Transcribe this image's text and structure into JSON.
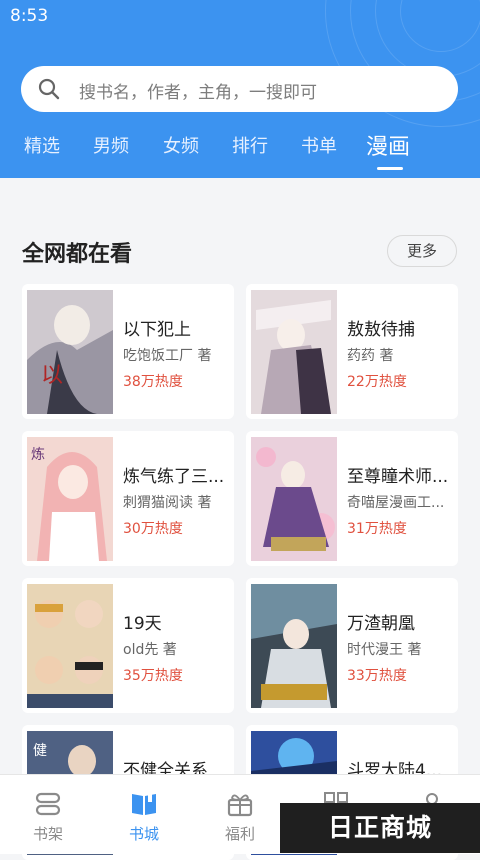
{
  "status_bar": {
    "time": "8:53"
  },
  "search": {
    "placeholder": "搜书名，作者，主角，一搜即可"
  },
  "tabs": [
    "精选",
    "男频",
    "女频",
    "排行",
    "书单",
    "漫画"
  ],
  "active_tab": "漫画",
  "section": {
    "title": "全网都在看",
    "more_label": "更多"
  },
  "books": [
    {
      "title": "以下犯上",
      "author": "吃饱饭工厂 著",
      "heat": "38万热度",
      "cover_color": "#c9c5cb"
    },
    {
      "title": "敖敖待捕",
      "author": "药药 著",
      "heat": "22万热度",
      "cover_color": "#d9cfd3"
    },
    {
      "title": "炼气练了三...",
      "author": "刺猬猫阅读 著",
      "heat": "30万热度",
      "cover_color": "#f1d2cf"
    },
    {
      "title": "至尊瞳术师...",
      "author": "奇喵屋漫画工...",
      "heat": "31万热度",
      "cover_color": "#e6c1d0"
    },
    {
      "title": "19天",
      "author": "old先 著",
      "heat": "35万热度",
      "cover_color": "#d6c09d"
    },
    {
      "title": "万渣朝凰",
      "author": "时代漫王 著",
      "heat": "33万热度",
      "cover_color": "#6d8c9d"
    },
    {
      "title": "不健全关系",
      "author": "",
      "heat": "",
      "cover_color": "#4d6082"
    },
    {
      "title": "斗罗大陆4...",
      "author": "",
      "heat": "",
      "cover_color": "#3b5fb0"
    }
  ],
  "bottom_nav": [
    {
      "label": "书架",
      "icon": "bookshelf-icon"
    },
    {
      "label": "书城",
      "icon": "book-store-icon"
    },
    {
      "label": "福利",
      "icon": "gift-icon"
    },
    {
      "label": "",
      "icon": "category-icon"
    },
    {
      "label": "",
      "icon": "profile-icon"
    }
  ],
  "active_nav": "书城",
  "watermark": "日正商城",
  "colors": {
    "primary": "#3c93f0",
    "heat": "#e0513f"
  }
}
